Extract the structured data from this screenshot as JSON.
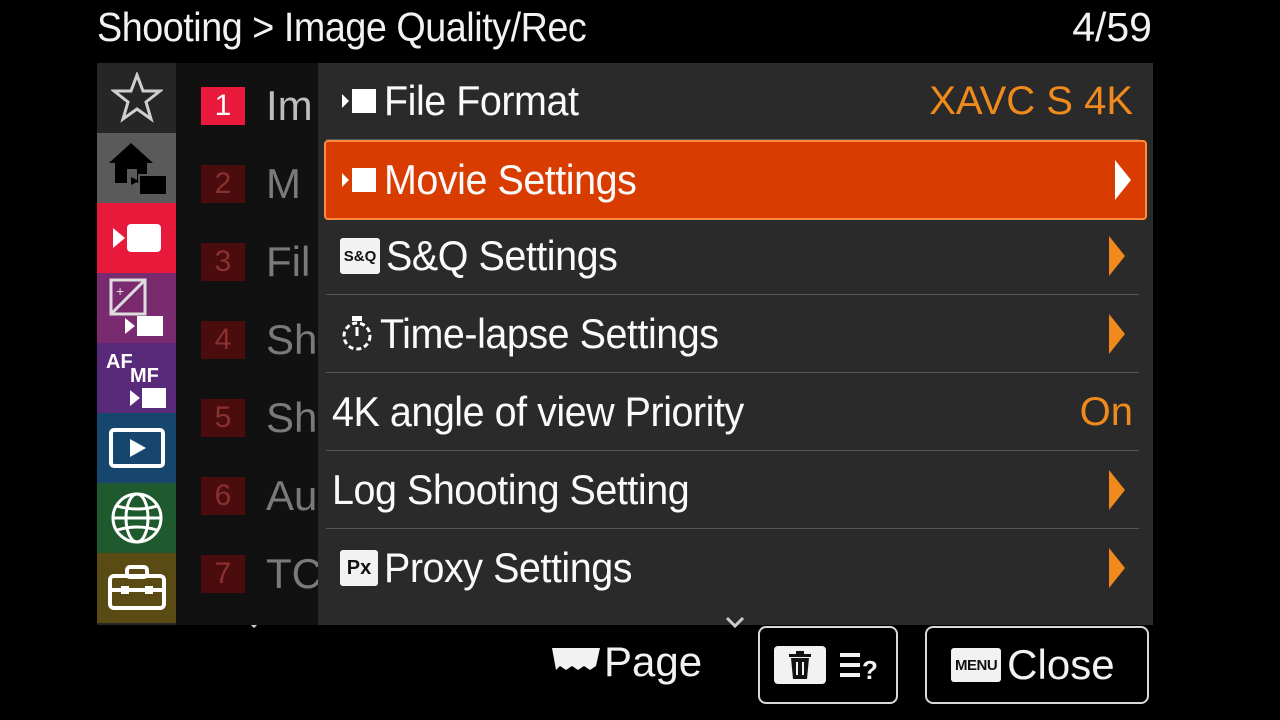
{
  "header": {
    "breadcrumb": "Shooting > Image Quality/Rec",
    "page_indicator": "4/59"
  },
  "categories": [
    {
      "icon": "star-icon",
      "color": "#262626"
    },
    {
      "icon": "home-movie-icon",
      "color": "#5a5a5a"
    },
    {
      "icon": "movie-camera-icon",
      "color": "#e8193a",
      "active": true
    },
    {
      "icon": "exposure-icon",
      "color": "#7a2a6e"
    },
    {
      "icon": "af-mf-icon",
      "color": "#5a2a7a"
    },
    {
      "icon": "playback-icon",
      "color": "#16456e"
    },
    {
      "icon": "globe-icon",
      "color": "#1f5a2e"
    },
    {
      "icon": "toolbox-icon",
      "color": "#5a4a14"
    }
  ],
  "pages": [
    {
      "num": "1",
      "label": "Im",
      "active": true
    },
    {
      "num": "2",
      "label": "M"
    },
    {
      "num": "3",
      "label": "Fil"
    },
    {
      "num": "4",
      "label": "Sh"
    },
    {
      "num": "5",
      "label": "Sh"
    },
    {
      "num": "6",
      "label": "Au"
    },
    {
      "num": "7",
      "label": "TC"
    }
  ],
  "menu": [
    {
      "label": "File Format",
      "icon": "movie-mode-icon",
      "value": "XAVC S 4K"
    },
    {
      "label": "Movie Settings",
      "icon": "movie-mode-icon",
      "selected": true,
      "arrow": true
    },
    {
      "label": "S&Q Settings",
      "icon": "sq-icon",
      "icon_text": "S&Q",
      "arrow": true
    },
    {
      "label": "Time-lapse Settings",
      "icon": "timelapse-icon",
      "arrow": true
    },
    {
      "label": "4K angle of view Priority",
      "value": "On"
    },
    {
      "label": "Log Shooting Setting",
      "arrow": true
    },
    {
      "label": "Proxy Settings",
      "icon": "proxy-icon",
      "icon_text": "Px",
      "arrow": true
    }
  ],
  "footer": {
    "page_label": "Page",
    "menu_key": "MENU",
    "close_label": "Close"
  },
  "colors": {
    "accent": "#f08a1c",
    "selected_bg": "#d93c00",
    "active_tab": "#e8193a"
  }
}
